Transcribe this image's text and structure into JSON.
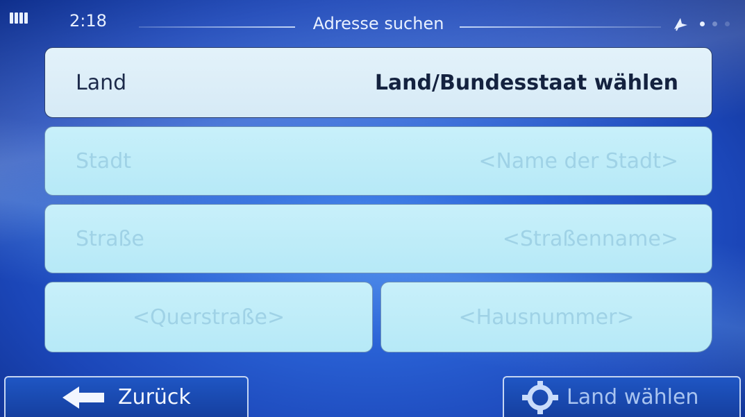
{
  "status": {
    "time": "2:18",
    "title": "Adresse suchen"
  },
  "icons": {
    "battery": "battery-icon",
    "gps": "gps-satellite-icon",
    "back": "arrow-left-icon",
    "target": "crosshair-icon"
  },
  "colors": {
    "background": "#2a62d6",
    "field_bg": "#c8f0fa",
    "active_text": "#14223f",
    "disabled_text": "#9fd2e6"
  },
  "form": {
    "country": {
      "label": "Land",
      "value": "Land/Bundesstaat wählen"
    },
    "city": {
      "label": "Stadt",
      "placeholder": "<Name der Stadt>"
    },
    "street": {
      "label": "Straße",
      "placeholder": "<Straßenname>"
    },
    "cross_street": {
      "placeholder": "<Querstraße>"
    },
    "house_number": {
      "placeholder": "<Hausnummer>"
    }
  },
  "footer": {
    "back_label": "Zurück",
    "select_country_label": "Land wählen"
  }
}
